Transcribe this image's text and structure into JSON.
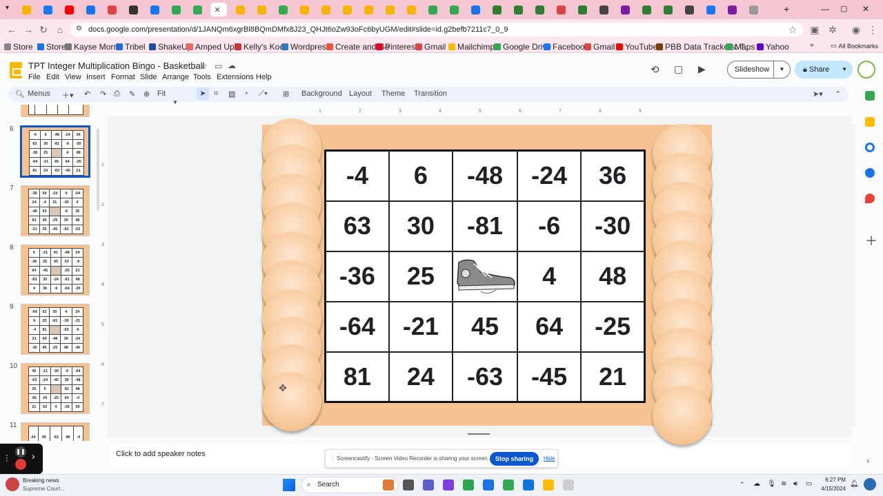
{
  "browser": {
    "url": "docs.google.com/presentation/d/1JANQm6xgrBl8BQmDMfx8J23_QHJt6oZw93oFc6byUGM/edit#slide=id.g2befb7211c7_0_9",
    "bookmarks": [
      "Store",
      "Store",
      "Kayse Morris",
      "Tribel",
      "ShakeUp",
      "Amped Up",
      "Kelly's Kool",
      "Wordpress",
      "Create and Go",
      "Pinterest",
      "Gmail",
      "Mailchimp",
      "Google Drive",
      "Facebook",
      "Gmail",
      "YouTube",
      "PBB Data Trackers: T...",
      "Maps",
      "Yahoo"
    ],
    "all_bookmarks": "All Bookmarks",
    "bookmark_colors": [
      "#888",
      "#1a73e8",
      "#777",
      "#1d6ce0",
      "#1b4ea3",
      "#e66",
      "#c33",
      "#2a7bb9",
      "#e53",
      "#e60023",
      "#d44",
      "#fbbc04",
      "#34a853",
      "#1877f2",
      "#d44",
      "#f00",
      "#7b3f00",
      "#34a853",
      "#6001d2"
    ]
  },
  "app": {
    "title": "TPT Integer Multiplication Bingo - Basketball",
    "menus": [
      "File",
      "Edit",
      "View",
      "Insert",
      "Format",
      "Slide",
      "Arrange",
      "Tools",
      "Extensions",
      "Help"
    ],
    "slideshow_label": "Slideshow",
    "share_label": "Share",
    "toolbar": {
      "search": "Menus",
      "zoom": "Fit",
      "background": "Background",
      "layout": "Layout",
      "theme": "Theme",
      "transition": "Transition"
    },
    "notes_placeholder": "Click to add speaker notes",
    "ruler_marks": [
      "1",
      "2",
      "3",
      "4",
      "5",
      "6",
      "7",
      "8",
      "9"
    ],
    "vruler_marks": [
      "1",
      "2",
      "3",
      "4",
      "5",
      "6",
      "7"
    ]
  },
  "filmstrip": {
    "slides": [
      {
        "number": "6",
        "rows": [
          [
            "-4",
            "6",
            "-48",
            "-24",
            "36"
          ],
          [
            "63",
            "30",
            "-81",
            "-6",
            "-30"
          ],
          [
            "-36",
            "25",
            "",
            "4",
            "48"
          ],
          [
            "-64",
            "-21",
            "45",
            "64",
            "-25"
          ],
          [
            "81",
            "24",
            "-63",
            "-45",
            "21"
          ]
        ]
      },
      {
        "number": "7",
        "rows": [
          [
            "-36",
            "64",
            "-24",
            "4",
            "-64"
          ],
          [
            "24",
            "-4",
            "21",
            "-30",
            "6"
          ],
          [
            "-48",
            "63",
            "",
            "-6",
            "36"
          ],
          [
            "81",
            "45",
            "-25",
            "30",
            "48"
          ],
          [
            "-21",
            "25",
            "-45",
            "-81",
            "-63"
          ]
        ]
      },
      {
        "number": "8",
        "rows": [
          [
            "6",
            "-21",
            "81",
            "-48",
            "24"
          ],
          [
            "-36",
            "25",
            "45",
            "63",
            "-4"
          ],
          [
            "64",
            "-45",
            "",
            "-25",
            "21"
          ],
          [
            "-63",
            "30",
            "-24",
            "-81",
            "48"
          ],
          [
            "4",
            "36",
            "-6",
            "-64",
            "-30"
          ]
        ]
      },
      {
        "number": "9",
        "rows": [
          [
            "-64",
            "63",
            "30",
            "4",
            "24"
          ],
          [
            "6",
            "25",
            "-81",
            "-30",
            "-21"
          ],
          [
            "-4",
            "81",
            "",
            "-63",
            "-6"
          ],
          [
            "21",
            "64",
            "-48",
            "36",
            "-24"
          ],
          [
            "-36",
            "45",
            "-25",
            "48",
            "-45"
          ]
        ]
      },
      {
        "number": "10",
        "rows": [
          [
            "45",
            "-21",
            "-30",
            "-6",
            "-64"
          ],
          [
            "-63",
            "-24",
            "-45",
            "36",
            "-48"
          ],
          [
            "25",
            "6",
            "",
            "81",
            "48"
          ],
          [
            "-81",
            "24",
            "-25",
            "64",
            "-4"
          ],
          [
            "21",
            "63",
            "4",
            "-36",
            "30"
          ]
        ]
      },
      {
        "number": "11",
        "rows": [
          [
            "24",
            "45",
            "-63",
            "48",
            "-4"
          ],
          [
            "64",
            "-48",
            "25",
            "-81",
            "30"
          ]
        ]
      }
    ],
    "top_partial_row": [
      "4",
      "63",
      "25",
      "36",
      "-21"
    ]
  },
  "board": {
    "rows": [
      [
        "-4",
        "6",
        "-48",
        "-24",
        "36"
      ],
      [
        "63",
        "30",
        "-81",
        "-6",
        "-30"
      ],
      [
        "-36",
        "25",
        "",
        "4",
        "48"
      ],
      [
        "-64",
        "-21",
        "45",
        "64",
        "-25"
      ],
      [
        "81",
        "24",
        "-63",
        "-45",
        "21"
      ]
    ],
    "free_space": "sneaker-icon"
  },
  "share_banner": {
    "text": "Screencastify - Screen Video Recorder is sharing your screen.",
    "stop": "Stop sharing",
    "hide": "Hide"
  },
  "taskbar": {
    "news_title": "Breaking news",
    "news_sub": "Supreme Court...",
    "search": "Search",
    "time": "6:27 PM",
    "date": "4/15/2024"
  }
}
